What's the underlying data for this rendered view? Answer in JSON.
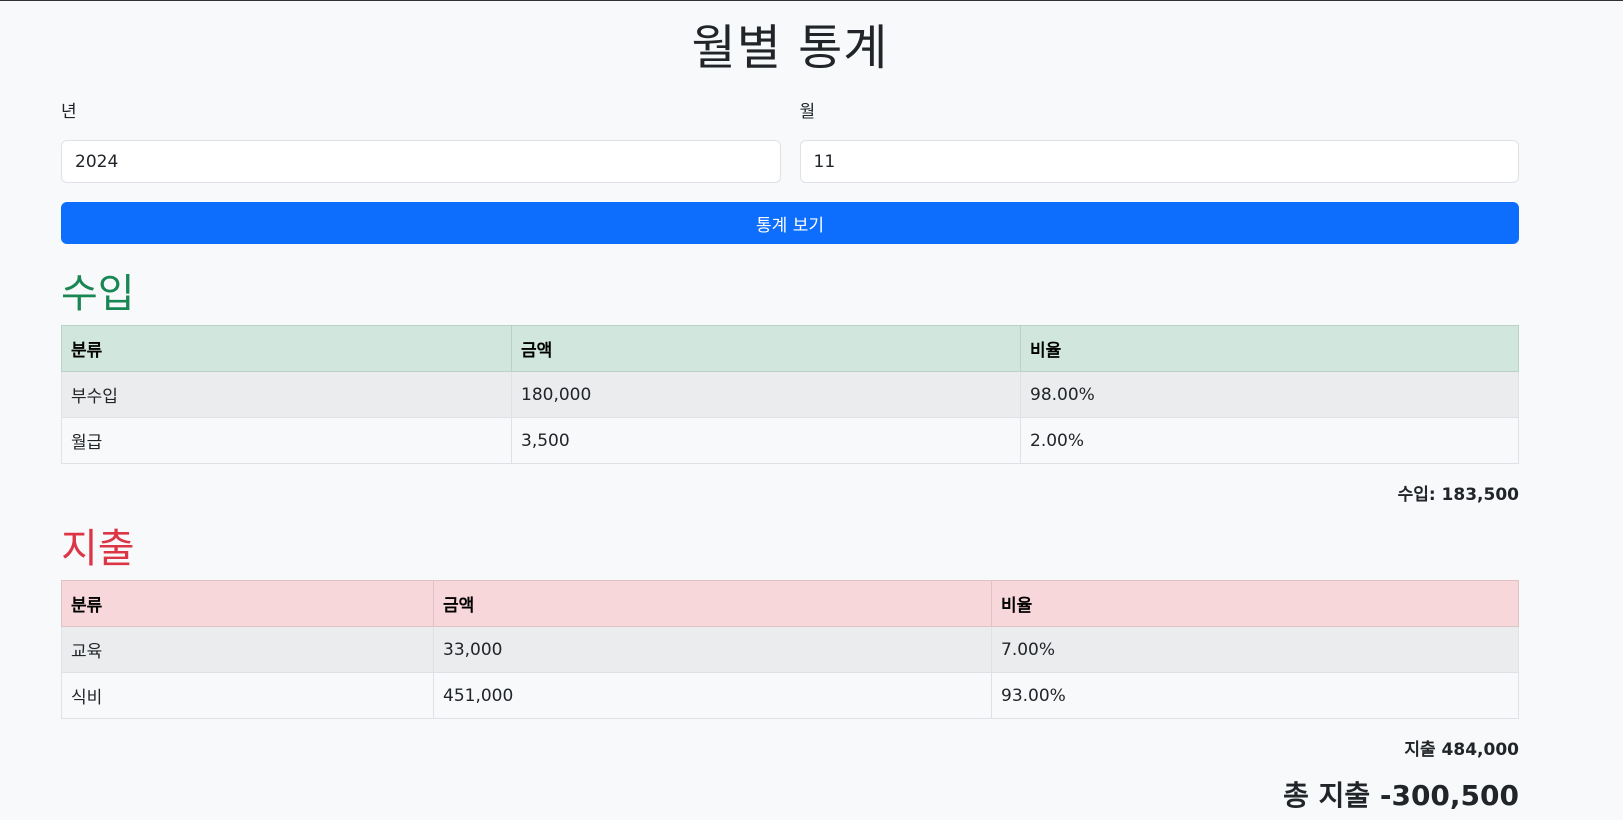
{
  "page": {
    "title": "월별 통계"
  },
  "form": {
    "year_label": "년",
    "year_value": "2024",
    "month_label": "월",
    "month_value": "11",
    "submit_label": "통계 보기"
  },
  "income": {
    "heading": "수입",
    "columns": [
      "분류",
      "금액",
      "비율"
    ],
    "rows": [
      [
        "부수입",
        "180,000",
        "98.00%"
      ],
      [
        "월급",
        "3,500",
        "2.00%"
      ]
    ],
    "total_text": "수입: 183,500"
  },
  "expense": {
    "heading": "지출",
    "columns": [
      "분류",
      "금액",
      "비율"
    ],
    "rows": [
      [
        "교육",
        "33,000",
        "7.00%"
      ],
      [
        "식비",
        "451,000",
        "93.00%"
      ]
    ],
    "total_text": "지출 484,000"
  },
  "summary": {
    "net_text": "총 지출 -300,500"
  },
  "colors": {
    "primary": "#0d6efd",
    "income": "#198754",
    "expense": "#dc3545",
    "income_header_bg": "#d1e7dd",
    "expense_header_bg": "#f8d7da"
  }
}
